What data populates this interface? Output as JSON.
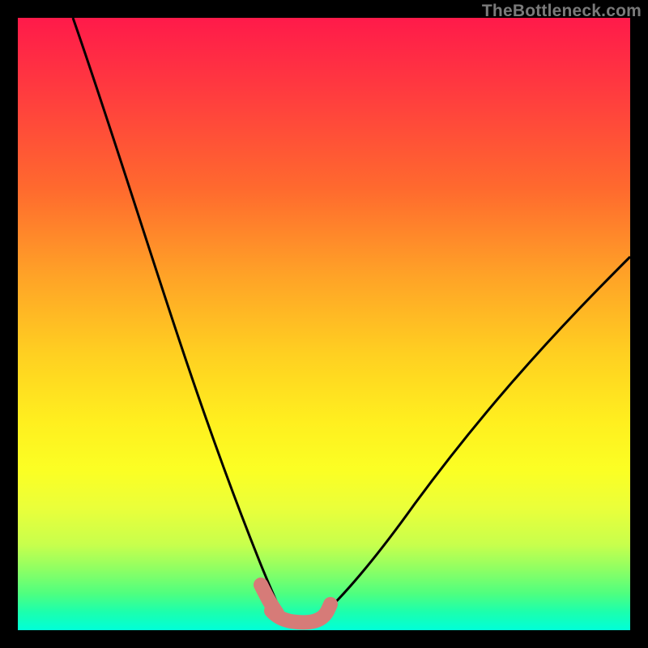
{
  "watermark": "TheBottleneck.com",
  "chart_data": {
    "type": "line",
    "title": "",
    "xlabel": "",
    "ylabel": "",
    "ylim": [
      0,
      100
    ],
    "xlim": [
      0,
      100
    ],
    "series": [
      {
        "name": "left-curve",
        "x": [
          9,
          12,
          15,
          18,
          22,
          26,
          30,
          34,
          37,
          39,
          40,
          41,
          42
        ],
        "y": [
          100,
          88,
          75,
          63,
          50,
          38,
          26,
          15,
          8,
          4,
          2,
          1,
          0
        ]
      },
      {
        "name": "right-curve",
        "x": [
          48,
          50,
          53,
          57,
          62,
          68,
          74,
          81,
          88,
          95,
          100
        ],
        "y": [
          0,
          2,
          5,
          10,
          17,
          25,
          33,
          41,
          49,
          56,
          62
        ]
      },
      {
        "name": "bottom-bar",
        "x": [
          41,
          42,
          43,
          44,
          45,
          46,
          47,
          48,
          49,
          50
        ],
        "y": [
          2.2,
          1.6,
          1.2,
          1.0,
          0.9,
          0.9,
          1.0,
          1.3,
          1.8,
          2.4
        ]
      },
      {
        "name": "left-stub",
        "x": [
          39.5,
          40.2,
          41.0,
          41.8
        ],
        "y": [
          6.5,
          4.2,
          2.6,
          1.8
        ]
      }
    ],
    "colors": {
      "curve": "#000000",
      "highlight": "#d67b78"
    }
  }
}
